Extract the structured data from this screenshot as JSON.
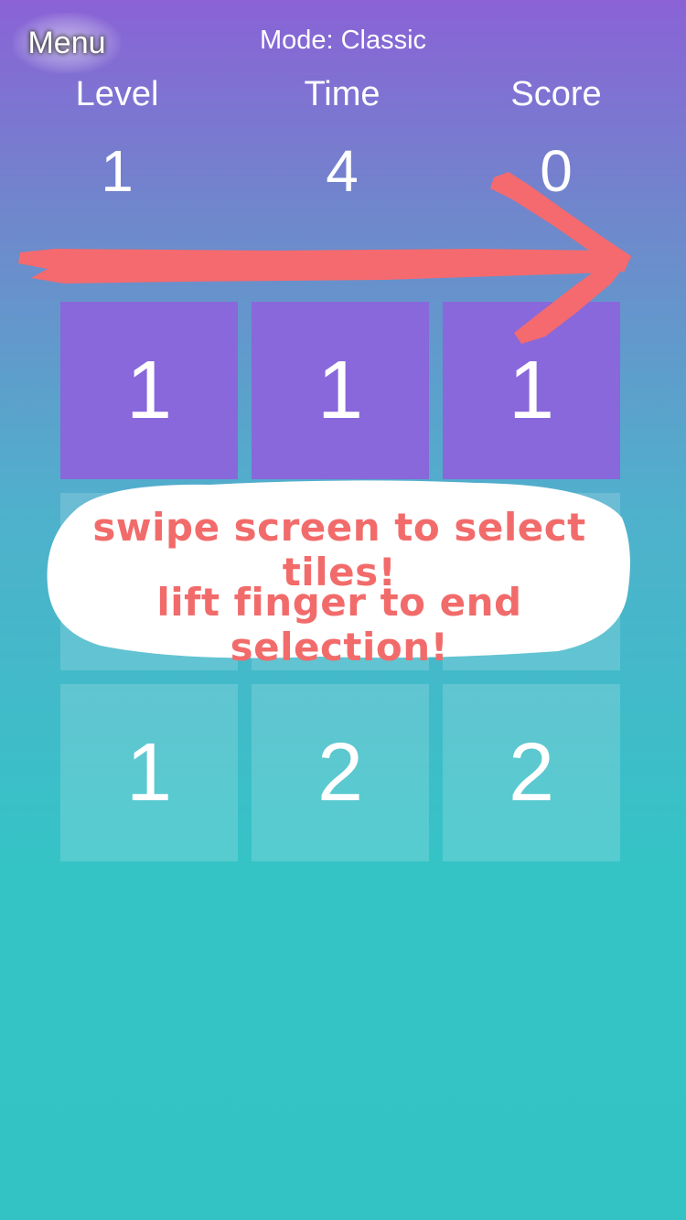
{
  "header": {
    "menu_label": "Menu",
    "mode_label": "Mode: Classic"
  },
  "stats": {
    "level": {
      "label": "Level",
      "value": "1"
    },
    "time": {
      "label": "Time",
      "value": "4"
    },
    "score": {
      "label": "Score",
      "value": "0"
    }
  },
  "grid": {
    "rows": [
      [
        "1",
        "1",
        "1"
      ],
      [
        "",
        "",
        ""
      ],
      [
        "1",
        "2",
        "2"
      ]
    ],
    "selected_row": 0
  },
  "tutorial": {
    "line1": "swipe screen to select tiles!",
    "line2": "lift finger to end selection!",
    "arrow_icon": "swipe-right-arrow-icon"
  },
  "colors": {
    "gradient_top": "#8a62d6",
    "gradient_bottom": "#33c3c4",
    "selected_tile": "#8868db",
    "tutorial_text": "#f26b6b",
    "arrow": "#f46a6e"
  }
}
